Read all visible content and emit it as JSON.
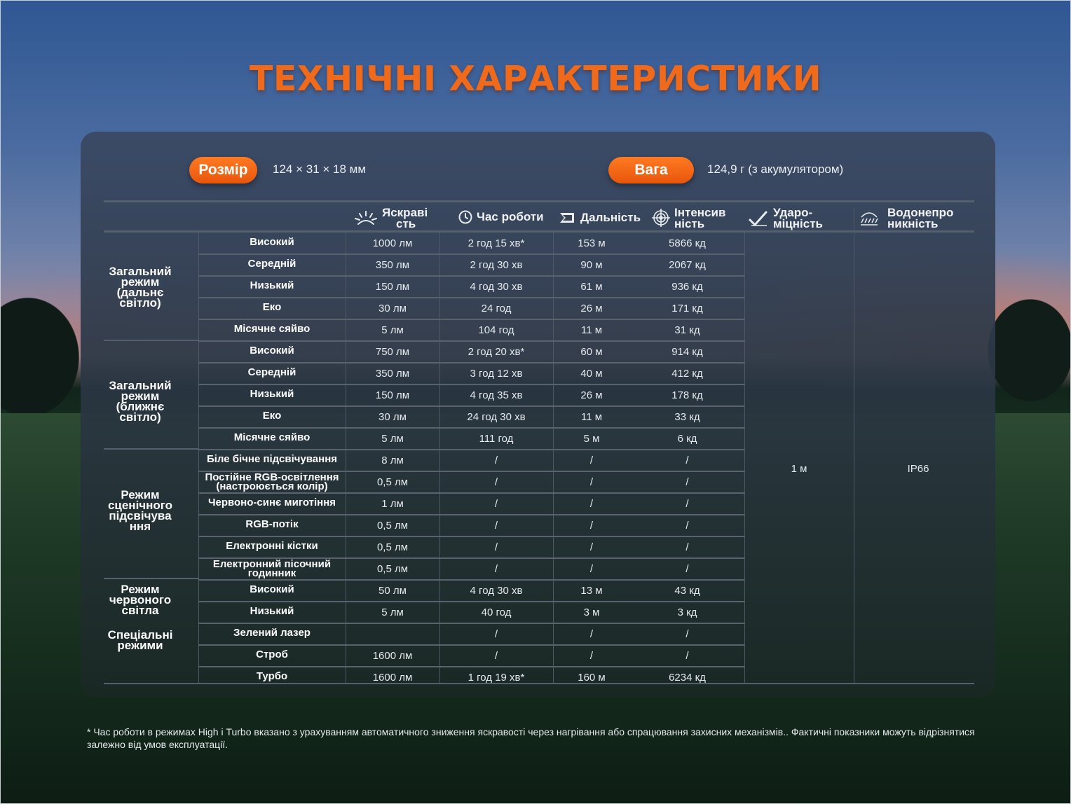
{
  "title": "ТЕХНІЧНІ ХАРАКТЕРИСТИКИ",
  "specs": {
    "size_label": "Розмір",
    "size_value": "124 × 31 × 18 мм",
    "weight_label": "Вага",
    "weight_value": "124,9 г (з акумулятором)"
  },
  "headers": {
    "brightness": [
      "Яскраві",
      "сть"
    ],
    "runtime": "Час роботи",
    "distance": "Дальність",
    "intensity": [
      "Інтенсив",
      "ність"
    ],
    "impact": [
      "Ударо-",
      "міцність"
    ],
    "water": [
      "Водонепро",
      "никність"
    ]
  },
  "groups": [
    {
      "label": [
        "Загальний",
        "режим",
        "(дальнє",
        "світло)"
      ]
    },
    {
      "label": [
        "Загальний",
        "режим",
        "(ближнє",
        "світло)"
      ]
    },
    {
      "label": [
        "Режим",
        "сценічного",
        "підсвічува",
        "ння"
      ]
    },
    {
      "label": [
        "Режим",
        "червоного",
        "світла"
      ]
    },
    {
      "label": [
        "Спеціальні",
        "режими"
      ]
    }
  ],
  "rows": [
    {
      "mode": [
        "Високий"
      ],
      "brightness": "1000 лм",
      "runtime": "2 год 15 хв*",
      "distance": "153 м",
      "intensity": "5866 кд"
    },
    {
      "mode": [
        "Середній"
      ],
      "brightness": "350 лм",
      "runtime": "2 год 30 хв",
      "distance": "90 м",
      "intensity": "2067 кд"
    },
    {
      "mode": [
        "Низький"
      ],
      "brightness": "150 лм",
      "runtime": "4 год 30 хв",
      "distance": "61 м",
      "intensity": "936 кд"
    },
    {
      "mode": [
        "Еко"
      ],
      "brightness": "30 лм",
      "runtime": "24 год",
      "distance": "26 м",
      "intensity": "171 кд"
    },
    {
      "mode": [
        "Місячне сяйво"
      ],
      "brightness": "5 лм",
      "runtime": "104 год",
      "distance": "11 м",
      "intensity": "31 кд"
    },
    {
      "mode": [
        "Високий"
      ],
      "brightness": "750 лм",
      "runtime": "2 год 20 хв*",
      "distance": "60 м",
      "intensity": "914 кд"
    },
    {
      "mode": [
        "Середній"
      ],
      "brightness": "350 лм",
      "runtime": "3 год 12 хв",
      "distance": "40 м",
      "intensity": "412 кд"
    },
    {
      "mode": [
        "Низький"
      ],
      "brightness": "150 лм",
      "runtime": "4 год 35 хв",
      "distance": "26 м",
      "intensity": "178 кд"
    },
    {
      "mode": [
        "Еко"
      ],
      "brightness": "30 лм",
      "runtime": "24 год 30 хв",
      "distance": "11 м",
      "intensity": "33 кд"
    },
    {
      "mode": [
        "Місячне сяйво"
      ],
      "brightness": "5 лм",
      "runtime": "111 год",
      "distance": "5 м",
      "intensity": "6 кд"
    },
    {
      "mode": [
        "Біле бічне підсвічування"
      ],
      "brightness": "8 лм",
      "runtime": "/",
      "distance": "/",
      "intensity": "/"
    },
    {
      "mode": [
        "Постійне RGB-освітлення",
        "(настроюється колір)"
      ],
      "brightness": "0,5 лм",
      "runtime": "/",
      "distance": "/",
      "intensity": "/"
    },
    {
      "mode": [
        "Червоно-синє миготіння"
      ],
      "brightness": "1 лм",
      "runtime": "/",
      "distance": "/",
      "intensity": "/"
    },
    {
      "mode": [
        "RGB-потік"
      ],
      "brightness": "0,5 лм",
      "runtime": "/",
      "distance": "/",
      "intensity": "/"
    },
    {
      "mode": [
        "Електронні кістки"
      ],
      "brightness": "0,5 лм",
      "runtime": "/",
      "distance": "/",
      "intensity": "/"
    },
    {
      "mode": [
        "Електронний пісочний",
        "годинник"
      ],
      "brightness": "0,5 лм",
      "runtime": "/",
      "distance": "/",
      "intensity": "/"
    },
    {
      "mode": [
        "Високий"
      ],
      "brightness": "50 лм",
      "runtime": "4 год 30 хв",
      "distance": "13 м",
      "intensity": "43 кд"
    },
    {
      "mode": [
        "Низький"
      ],
      "brightness": "5 лм",
      "runtime": "40 год",
      "distance": "3 м",
      "intensity": "3 кд"
    },
    {
      "mode": [
        "Зелений лазер"
      ],
      "brightness": "",
      "runtime": "/",
      "distance": "/",
      "intensity": "/"
    },
    {
      "mode": [
        "Строб"
      ],
      "brightness": "1600 лм",
      "runtime": "/",
      "distance": "/",
      "intensity": "/"
    },
    {
      "mode": [
        "Турбо"
      ],
      "brightness": "1600 лм",
      "runtime": "1 год 19 хв*",
      "distance": "160 м",
      "intensity": "6234 кд"
    }
  ],
  "merged": {
    "impact": "1 м",
    "water": "IP66"
  },
  "footnote": "* Час роботи в режимах High і Turbo вказано з урахуванням автоматичного зниження яскравості через нагрівання або спрацювання захисних механізмів.. Фактичні показники можуть відрізнятися залежно від умов експлуатації."
}
